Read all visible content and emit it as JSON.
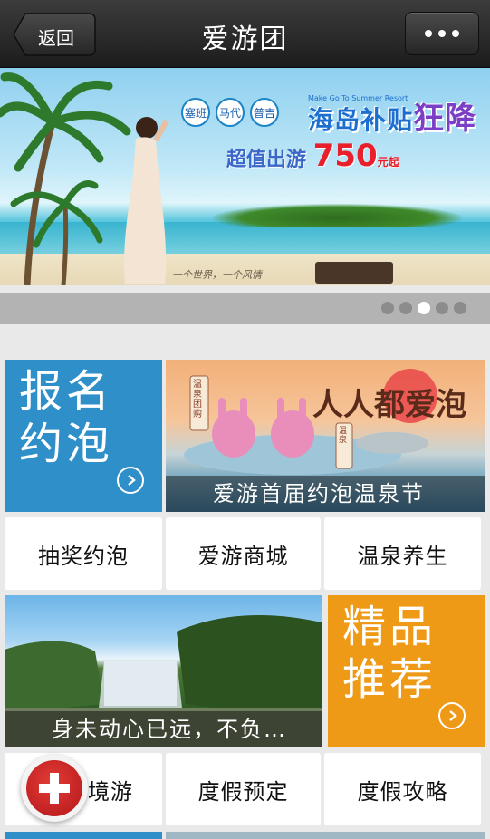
{
  "header": {
    "back_label": "返回",
    "title": "爱游团",
    "more_icon": "more-dots-icon"
  },
  "banner": {
    "destinations": [
      "塞班",
      "马代",
      "普吉"
    ],
    "promo_subtitle": "Make Go To Summer Resort",
    "promo_title": "海岛补贴",
    "promo_title_emphasis": "狂降",
    "price_prefix": "超值出游",
    "price_value": "750",
    "price_unit": "元起",
    "slogan": "一个世界，一个风情",
    "carousel_total": 5,
    "carousel_active": 3
  },
  "tiles": {
    "signup": {
      "line1": "报名",
      "line2": "约泡",
      "icon": "chevron-right-circle-icon",
      "color": "#2e8fc9"
    },
    "onsen": {
      "sign_left": "温泉团购",
      "sign_right": "温泉",
      "headline": "人人都爱泡",
      "caption": "爱游首届约泡温泉节"
    },
    "waterfall": {
      "caption": "身未动心已远，不负…"
    },
    "featured": {
      "line1": "精品",
      "line2": "推荐",
      "icon": "chevron-right-circle-icon",
      "color": "#ef9a17"
    }
  },
  "menu_row1": [
    "抽奖约泡",
    "爱游商城",
    "温泉养生"
  ],
  "menu_row2": [
    "境游",
    "度假预定",
    "度假攻略"
  ],
  "fab": {
    "icon": "plus-icon",
    "color": "#c8201f"
  }
}
